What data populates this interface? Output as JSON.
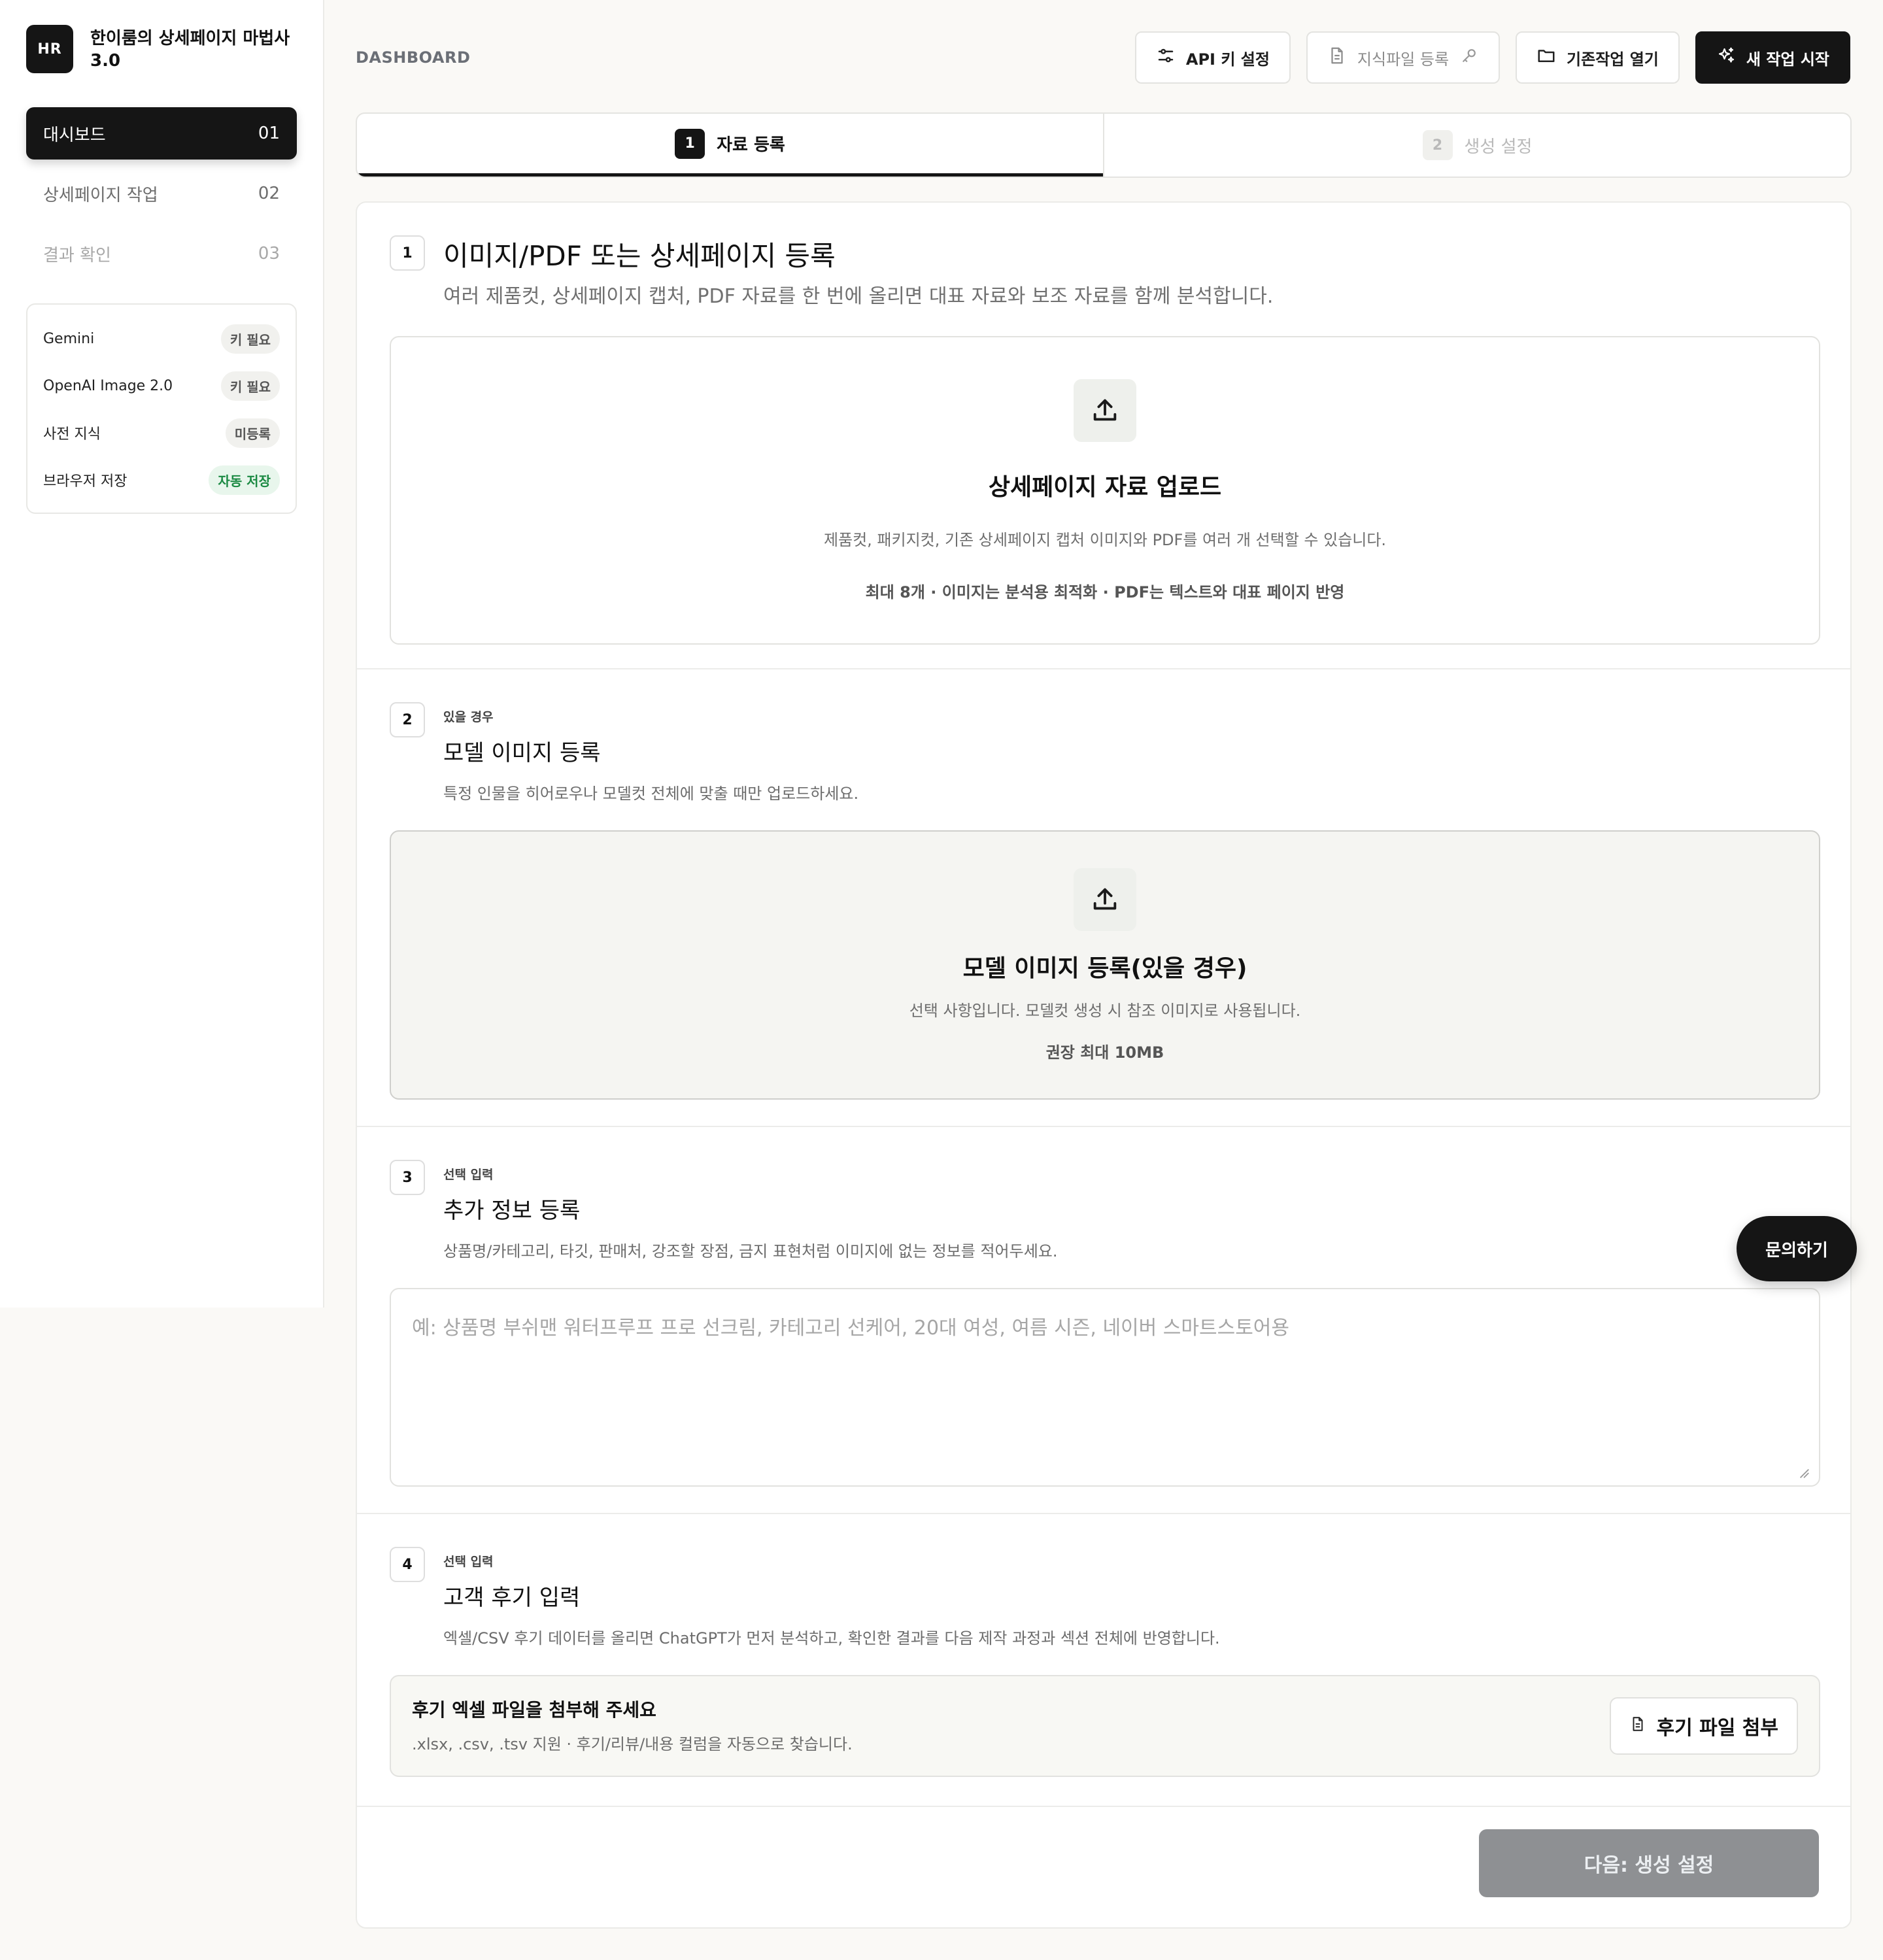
{
  "brand": {
    "logo": "HR",
    "title": "한이룸의 상세페이지 마법사 3.0"
  },
  "sidebar": {
    "nav": [
      {
        "label": "대시보드",
        "num": "01"
      },
      {
        "label": "상세페이지 작업",
        "num": "02"
      },
      {
        "label": "결과 확인",
        "num": "03"
      }
    ],
    "status": [
      {
        "label": "Gemini",
        "badge": "키 필요"
      },
      {
        "label": "OpenAI Image 2.0",
        "badge": "키 필요"
      },
      {
        "label": "사전 지식",
        "badge": "미등록"
      },
      {
        "label": "브라우저 저장",
        "badge": "자동 저장"
      }
    ]
  },
  "header": {
    "page_label": "DASHBOARD",
    "buttons": {
      "api": "API 키 설정",
      "knowledge": "지식파일 등록",
      "open": "기존작업 열기",
      "new": "새 작업 시작"
    }
  },
  "stepper": [
    {
      "num": "1",
      "label": "자료 등록"
    },
    {
      "num": "2",
      "label": "생성 설정"
    }
  ],
  "sections": {
    "s1": {
      "num": "1",
      "title": "이미지/PDF 또는 상세페이지 등록",
      "desc": "여러 제품컷, 상세페이지 캡처, PDF 자료를 한 번에 올리면 대표 자료와 보조 자료를 함께 분석합니다.",
      "dz_title": "상세페이지 자료 업로드",
      "dz_desc": "제품컷, 패키지컷, 기존 상세페이지 캡처 이미지와 PDF를 여러 개 선택할 수 있습니다.",
      "dz_note": "최대 8개 · 이미지는 분석용 최적화 · PDF는 텍스트와 대표 페이지 반영"
    },
    "s2": {
      "num": "2",
      "tag": "있을 경우",
      "title": "모델 이미지 등록",
      "desc": "특정 인물을 히어로우나 모델컷 전체에 맞출 때만 업로드하세요.",
      "dz_title": "모델 이미지 등록(있을 경우)",
      "dz_desc": "선택 사항입니다. 모델컷 생성 시 참조 이미지로 사용됩니다.",
      "dz_note": "권장 최대 10MB"
    },
    "s3": {
      "num": "3",
      "tag": "선택 입력",
      "title": "추가 정보 등록",
      "desc": "상품명/카테고리, 타깃, 판매처, 강조할 장점, 금지 표현처럼 이미지에 없는 정보를 적어두세요.",
      "placeholder": "예: 상품명 부쉬맨 워터프루프 프로 선크림, 카테고리 선케어, 20대 여성, 여름 시즌, 네이버 스마트스토어용"
    },
    "s4": {
      "num": "4",
      "tag": "선택 입력",
      "title": "고객 후기 입력",
      "desc": "엑셀/CSV 후기 데이터를 올리면 ChatGPT가 먼저 분석하고, 확인한 결과를 다음 제작 과정과 섹션 전체에 반영합니다.",
      "box_title": "후기 엑셀 파일을 첨부해 주세요",
      "box_desc": ".xlsx, .csv, .tsv 지원 · 후기/리뷰/내용 컬럼을 자동으로 찾습니다.",
      "attach": "후기 파일 첨부"
    }
  },
  "next_button": "다음: 생성 설정",
  "fab": "문의하기"
}
